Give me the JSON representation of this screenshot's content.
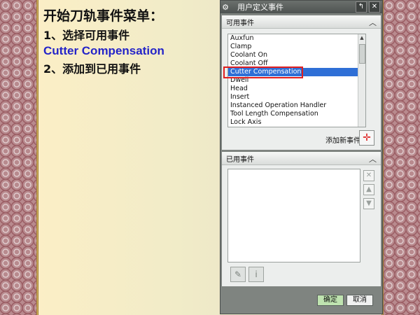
{
  "instructions": {
    "title": "开始刀轨事件菜单：",
    "step1": "1、选择可用事件",
    "event_name": "Cutter Compensation",
    "step2": "2、添加到已用事件"
  },
  "dialog": {
    "title": "用户定义事件",
    "title_buttons": [
      "↰",
      "✕"
    ],
    "available_section": "可用事件",
    "available_events": [
      "Auxfun",
      "Clamp",
      "Coolant On",
      "Coolant Off",
      "Cutter Compensation",
      "Dwell",
      "Head",
      "Insert",
      "Instanced Operation Handler",
      "Tool Length Compensation",
      "Lock Axis"
    ],
    "selected_event": "Cutter Compensation",
    "add_event_label": "添加新事件",
    "used_section": "已用事件",
    "ok_label": "确定",
    "cancel_label": "取消"
  },
  "colors": {
    "selection": "#2f6fd6",
    "highlight_text": "#2424c8",
    "annotation_box": "#e01f1f",
    "ok_button": "#bfe3b0"
  }
}
